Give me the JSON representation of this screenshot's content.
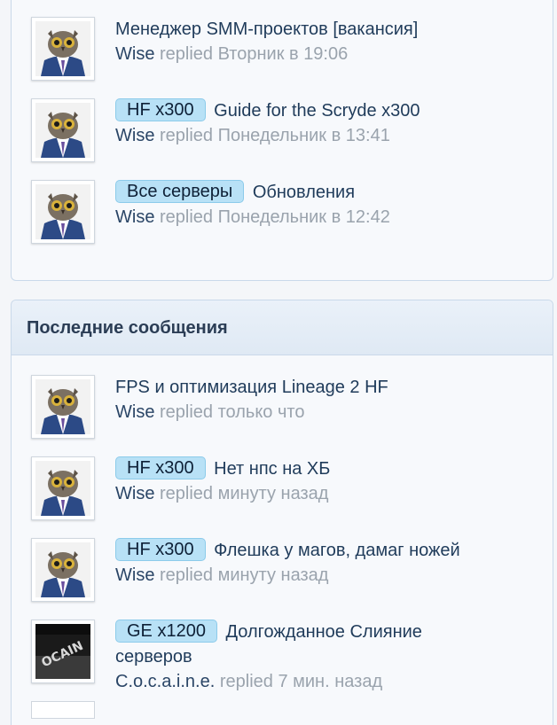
{
  "recent_threads": {
    "items": [
      {
        "prefix": "",
        "title": "Менеджер SMM-проектов [вакансия]",
        "user": "Wise",
        "action": "replied",
        "time": "Вторник в 19:06",
        "avatar": "owl-avatar-icon"
      },
      {
        "prefix": "HF x300",
        "title": "Guide for the Scryde x300",
        "user": "Wise",
        "action": "replied",
        "time": "Понедельник в 13:41",
        "avatar": "owl-avatar-icon"
      },
      {
        "prefix": "Все серверы",
        "title": "Обновления",
        "user": "Wise",
        "action": "replied",
        "time": "Понедельник в 12:42",
        "avatar": "owl-avatar-icon"
      }
    ]
  },
  "latest_messages": {
    "title": "Последние сообщения",
    "items": [
      {
        "prefix": "",
        "title": "FPS и оптимизация Lineage 2 HF",
        "user": "Wise",
        "action": "replied",
        "time": "только что",
        "avatar": "owl-avatar-icon"
      },
      {
        "prefix": "HF x300",
        "title": "Нет нпс на ХБ",
        "user": "Wise",
        "action": "replied",
        "time": "минуту назад",
        "avatar": "owl-avatar-icon"
      },
      {
        "prefix": "HF x300",
        "title": "Флешка у магов, дамаг ножей",
        "user": "Wise",
        "action": "replied",
        "time": "минуту назад",
        "avatar": "owl-avatar-icon"
      },
      {
        "prefix": "GE x1200",
        "title": "Долгожданное Слияние",
        "title_cont": "серверов",
        "user": "C.o.c.a.i.n.e.",
        "action": "replied",
        "time": "7 мин. назад",
        "avatar": "cocaine-avatar-icon"
      }
    ]
  },
  "colors": {
    "prefix_bg": "#b8e1f6",
    "link": "#1f3b5a",
    "muted": "#9aa3ad",
    "border": "#c9d9ea"
  }
}
